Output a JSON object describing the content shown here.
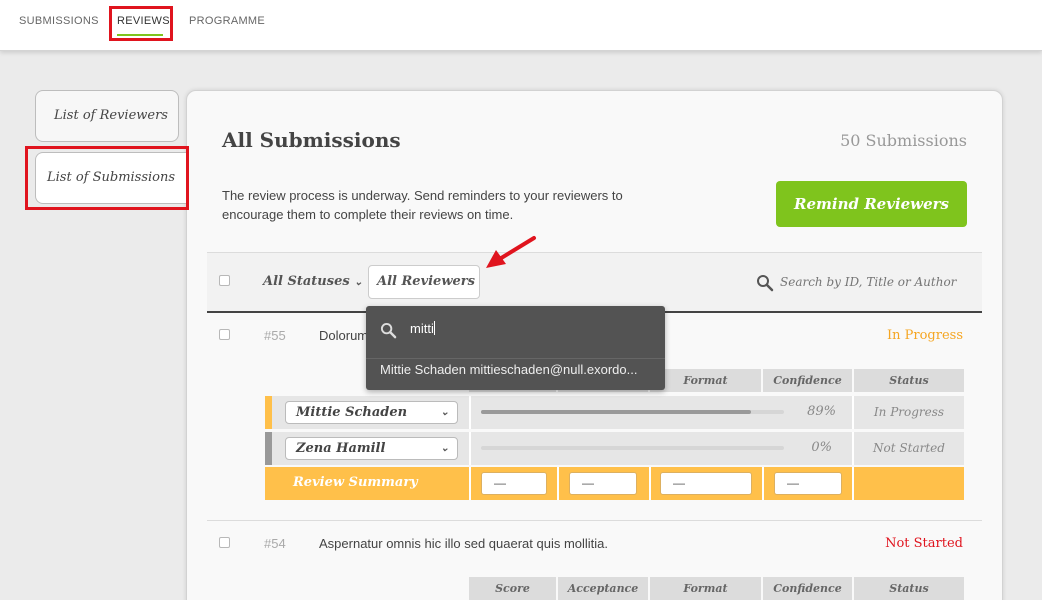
{
  "nav": {
    "tabs": [
      {
        "label": "SUBMISSIONS"
      },
      {
        "label": "REVIEWS"
      },
      {
        "label": "PROGRAMME"
      }
    ]
  },
  "sidebar": {
    "items": [
      {
        "label": "List of Reviewers"
      },
      {
        "label": "List of Submissions"
      }
    ]
  },
  "main": {
    "title": "All Submissions",
    "count": "50 Submissions",
    "description": "The review process is underway. Send reminders to your reviewers to encourage them to complete their reviews on time.",
    "remind_label": "Remind Reviewers",
    "filters": {
      "status_label": "All Statuses",
      "reviewer_label": "All Reviewers",
      "search_placeholder": "Search by ID, Title or Author"
    },
    "dropdown": {
      "query": "mitti",
      "option": "Mittie Schaden mittieschaden@null.exordo..."
    },
    "columns": [
      "Score",
      "Acceptance",
      "Format",
      "Confidence",
      "Status"
    ],
    "submissions": [
      {
        "id": "#55",
        "title": "Dolorum",
        "status": "In Progress",
        "reviewers": [
          {
            "name": "Mittie Schaden",
            "progress": 0.89,
            "percent": "89%",
            "status": "In Progress"
          },
          {
            "name": "Zena Hamill",
            "progress": 0,
            "percent": "0%",
            "status": "Not Started"
          }
        ],
        "summary_label": "Review Summary",
        "summary_values": [
          "—",
          "—",
          "—",
          "—"
        ]
      },
      {
        "id": "#54",
        "title": "Aspernatur omnis hic illo sed quaerat quis mollitia.",
        "status": "Not Started"
      }
    ]
  },
  "colors": {
    "accent_green": "#7fc41d",
    "in_progress": "#f5a623",
    "not_started": "#e0141e",
    "summary_bg": "#ffc04a"
  }
}
